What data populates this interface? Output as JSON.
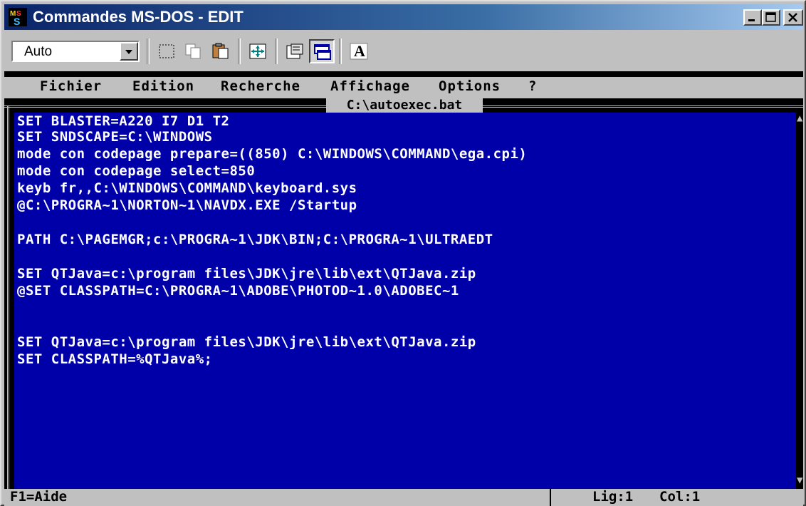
{
  "window": {
    "title": "Commandes MS-DOS - EDIT",
    "icon": "msdos-icon",
    "controls": {
      "minimize": "_",
      "maximize": "□",
      "close": "×"
    }
  },
  "toolbar": {
    "font_value": "Auto",
    "buttons": [
      "mark-icon",
      "copy-icon",
      "paste-icon",
      "fullscreen-icon",
      "properties-icon",
      "background-icon",
      "font-icon"
    ],
    "font_icon_glyph": "A"
  },
  "menu": {
    "items": [
      "Fichier",
      "Edition",
      "Recherche",
      "Affichage",
      "Options",
      "?"
    ]
  },
  "file_tab": "C:\\autoexec.bat",
  "editor": {
    "lines": [
      "SET BLASTER=A220 I7 D1 T2",
      "SET SNDSCAPE=C:\\WINDOWS",
      "mode con codepage prepare=((850) C:\\WINDOWS\\COMMAND\\ega.cpi)",
      "mode con codepage select=850",
      "keyb fr,,C:\\WINDOWS\\COMMAND\\keyboard.sys",
      "@C:\\PROGRA~1\\NORTON~1\\NAVDX.EXE /Startup",
      "",
      "PATH C:\\PAGEMGR;c:\\PROGRA~1\\JDK\\BIN;C:\\PROGRA~1\\ULTRAEDT",
      "",
      "SET QTJava=c:\\program files\\JDK\\jre\\lib\\ext\\QTJava.zip",
      "@SET CLASSPATH=C:\\PROGRA~1\\ADOBE\\PHOTOD~1.0\\ADOBEC~1",
      "",
      "",
      "SET QTJava=c:\\program files\\JDK\\jre\\lib\\ext\\QTJava.zip",
      "SET CLASSPATH=%QTJava%;"
    ]
  },
  "statusbar": {
    "help": "F1=Aide",
    "line": "Lig:1",
    "col": "Col:1"
  },
  "colors": {
    "editor_bg": "#0000a8",
    "text": "#ffffff",
    "chrome": "#c0c0c0",
    "title_bg": "#0a246a"
  }
}
